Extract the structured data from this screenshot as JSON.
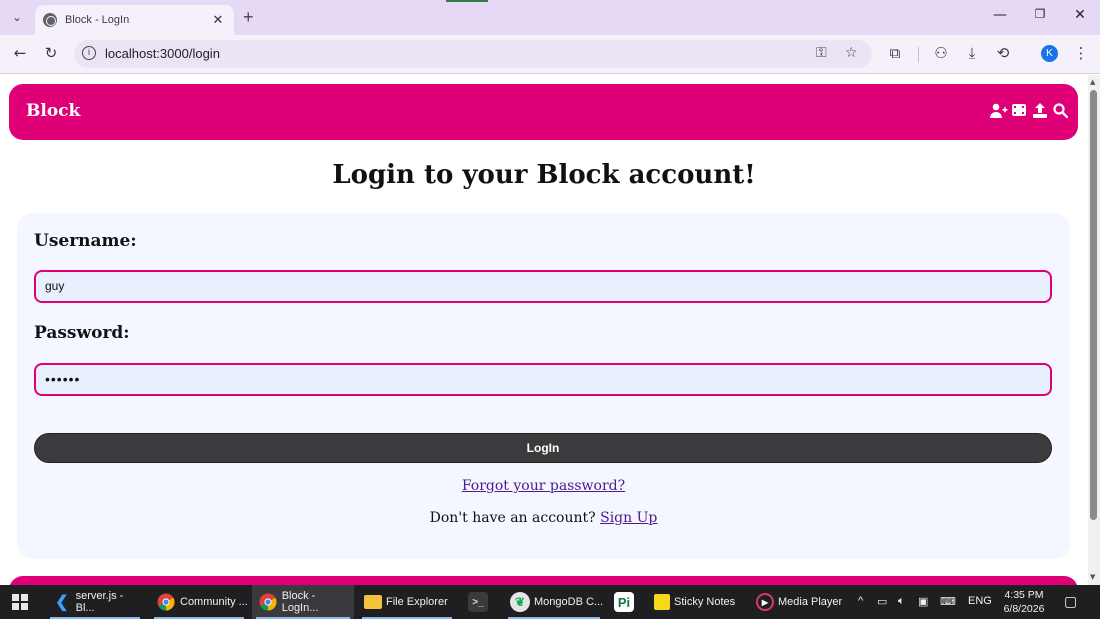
{
  "browser": {
    "tab_title": "Block - LogIn",
    "url": "localhost:3000/login",
    "profile_initial": "K"
  },
  "site": {
    "brand": "Block",
    "nav_icons": [
      "add-user-icon",
      "film-icon",
      "upload-icon",
      "search-icon"
    ]
  },
  "page": {
    "heading": "Login to your Block account!",
    "username_label": "Username:",
    "username_value": "guy",
    "password_label": "Password:",
    "password_value": "••••••",
    "login_button": "LogIn",
    "forgot_link": "Forgot your password?",
    "signup_prompt": "Don't have an account?",
    "signup_link": "Sign Up"
  },
  "taskbar": {
    "items": [
      {
        "label": "server.js - Bl...",
        "icon": "vscode-icon"
      },
      {
        "label": "Community ...",
        "icon": "chrome-icon"
      },
      {
        "label": "Block - LogIn...",
        "icon": "chrome-icon"
      },
      {
        "label": "File Explorer",
        "icon": "folder-icon"
      },
      {
        "label": "",
        "icon": "terminal-icon"
      },
      {
        "label": "MongoDB C...",
        "icon": "mongodb-icon"
      },
      {
        "label": "",
        "icon": "pi-icon"
      },
      {
        "label": "Sticky Notes",
        "icon": "sticky-notes-icon"
      },
      {
        "label": "Media Player",
        "icon": "media-player-icon"
      }
    ],
    "language": "ENG",
    "time": "4:35 PM",
    "date": "6/8/2026"
  },
  "colors": {
    "brand": "#df0077",
    "button": "#3c3a3d",
    "card_bg": "#f4f7ff"
  }
}
